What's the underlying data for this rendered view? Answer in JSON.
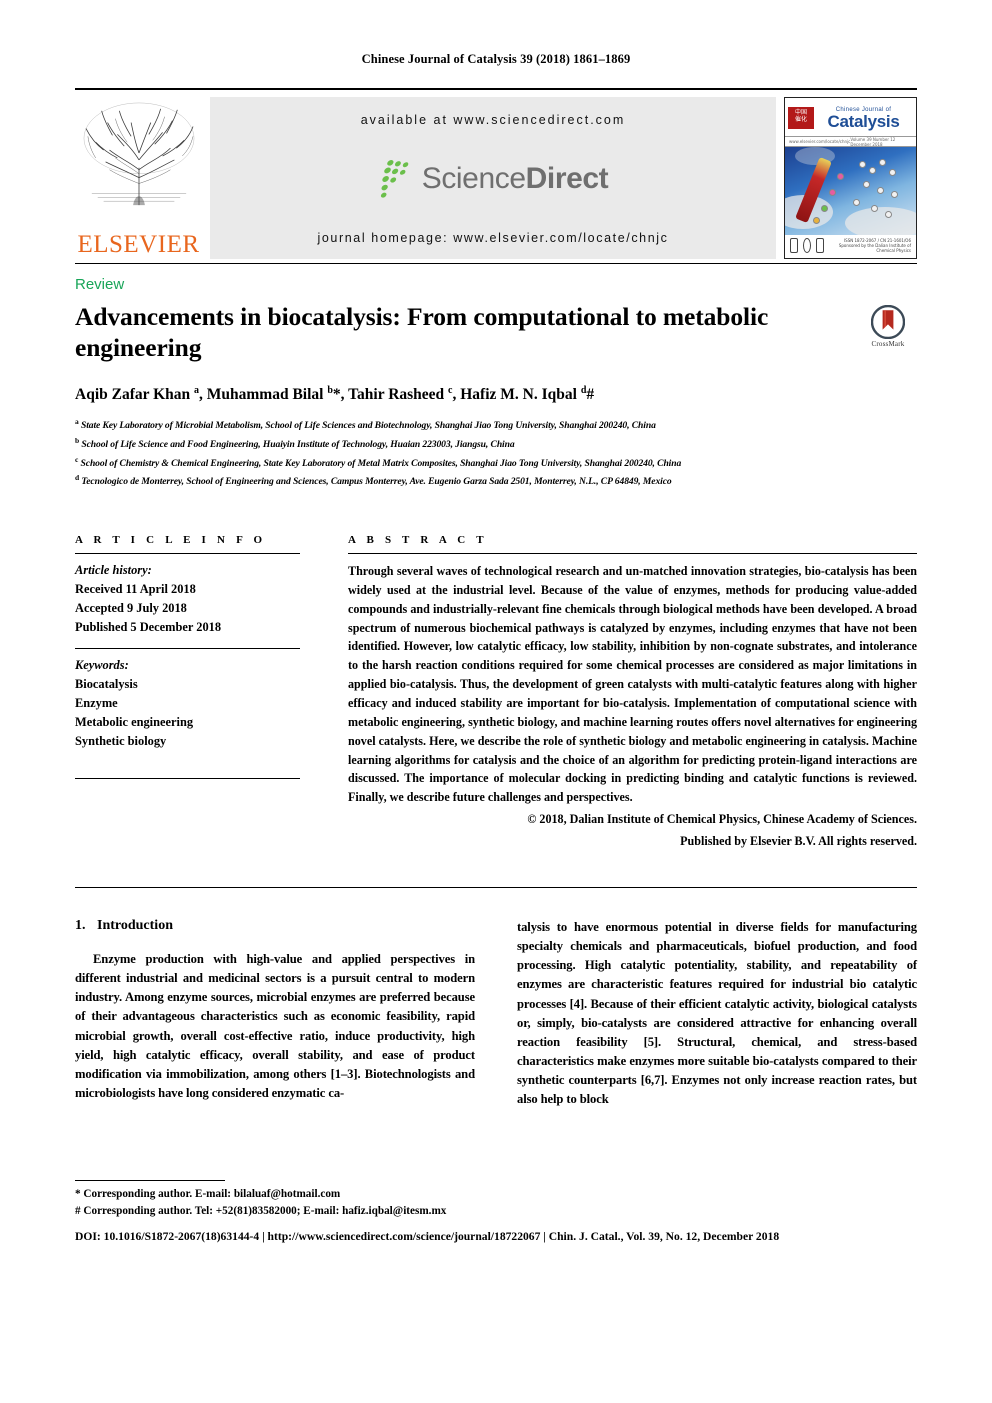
{
  "running_head": "Chinese Journal of Catalysis 39 (2018) 1861–1869",
  "masthead": {
    "publisher_name": "ELSEVIER",
    "available_at": "available at www.sciencedirect.com",
    "sciencedirect_wordmark_light": "Science",
    "sciencedirect_wordmark_bold": "Direct",
    "journal_homepage": "journal homepage: www.elsevier.com/locate/chnjc",
    "cover": {
      "title_small": "Chinese Journal of",
      "title_large": "Catalysis",
      "rule_left": "www.elsevier.com/locate/chnjc",
      "rule_right": "Volume 39   Number 12   December 2018",
      "footer_text": "ISSN 1872-2067 / CN 21-1601/O6  Sponsored by the Dalian Institute of Chemical Physics"
    }
  },
  "article": {
    "type_label": "Review",
    "title": "Advancements in biocatalysis: From computational to metabolic engineering",
    "crossmark_label": "CrossMark",
    "authors_html": "Aqib Zafar Khan <sup>a</sup>, Muhammad Bilal <sup>b</sup>*, Tahir Rasheed <sup>c</sup>, Hafiz M. N. Iqbal <sup>d</sup>#",
    "affiliations": [
      {
        "marker": "a",
        "text": "State Key Laboratory of Microbial Metabolism, School of Life Sciences and Biotechnology, Shanghai Jiao Tong University, Shanghai 200240, China"
      },
      {
        "marker": "b",
        "text": "School of Life Science and Food Engineering, Huaiyin Institute of Technology, Huaian 223003, Jiangsu, China"
      },
      {
        "marker": "c",
        "text": "School of Chemistry & Chemical Engineering, State Key Laboratory of Metal Matrix Composites, Shanghai Jiao Tong University, Shanghai 200240, China"
      },
      {
        "marker": "d",
        "text": "Tecnologico de Monterrey, School of Engineering and Sciences, Campus Monterrey, Ave. Eugenio Garza Sada 2501, Monterrey, N.L., CP 64849, Mexico"
      }
    ]
  },
  "article_info": {
    "heading": "A R T I C L E   I N F O",
    "history_label": "Article history:",
    "history": [
      "Received 11 April 2018",
      "Accepted 9 July 2018",
      "Published 5 December 2018"
    ],
    "keywords_label": "Keywords:",
    "keywords": [
      "Biocatalysis",
      "Enzyme",
      "Metabolic engineering",
      "Synthetic biology"
    ]
  },
  "abstract": {
    "heading": "A B S T R A C T",
    "text": "Through several waves of technological research and un-matched innovation strategies, bio-catalysis has been widely used at the industrial level. Because of the value of enzymes, methods for producing value-added compounds and industrially-relevant fine chemicals through biological methods have been developed. A broad spectrum of numerous biochemical pathways is catalyzed by enzymes, including enzymes that have not been identified. However, low catalytic efficacy, low stability, inhibition by non-cognate substrates, and intolerance to the harsh reaction conditions required for some chemical processes are considered as major limitations in applied bio-catalysis. Thus, the development of green catalysts with multi-catalytic features along with higher efficacy and induced stability are important for bio-catalysis. Implementation of computational science with metabolic engineering, synthetic biology, and machine learning routes offers novel alternatives for engineering novel catalysts. Here, we describe the role of synthetic biology and metabolic engineering in catalysis. Machine learning algorithms for catalysis and the choice of an algorithm for predicting protein-ligand interactions are discussed. The importance of molecular docking in predicting binding and catalytic functions is reviewed. Finally, we describe future challenges and perspectives.",
    "copyright_line1": "© 2018, Dalian Institute of Chemical Physics, Chinese Academy of Sciences.",
    "copyright_line2": "Published by Elsevier B.V. All rights reserved."
  },
  "body": {
    "section_number": "1.",
    "section_title": "Introduction",
    "left_paragraph": "Enzyme production with high-value and applied perspectives in different industrial and medicinal sectors is a pursuit central to modern industry. Among enzyme sources, microbial enzymes are preferred because of their advantageous characteristics such as economic feasibility, rapid microbial growth, overall cost-effective ratio, induce productivity, high yield, high catalytic efficacy, overall stability, and ease of product modification via immobilization, among others [1–3]. Biotechnologists and microbiologists have long considered enzymatic ca-",
    "right_paragraph": "talysis to have enormous potential in diverse fields for manufacturing specialty chemicals and pharmaceuticals, biofuel production, and food processing. High catalytic potentiality, stability, and repeatability of enzymes are characteristic features required for industrial bio catalytic processes [4]. Because of their efficient catalytic activity, biological catalysts or, simply, bio-catalysts are considered attractive for enhancing overall reaction feasibility [5]. Structural, chemical, and stress-based characteristics make enzymes more suitable bio-catalysts compared to their synthetic counterparts [6,7]. Enzymes not only increase reaction rates, but also help to block"
  },
  "footnotes": {
    "corresponding_1": "* Corresponding author. E-mail: bilaluaf@hotmail.com",
    "corresponding_2": "# Corresponding author. Tel: +52(81)83582000; E-mail: hafiz.iqbal@itesm.mx",
    "doi_line": "DOI: 10.1016/S1872-2067(18)63144-4 | http://www.sciencedirect.com/science/journal/18722067 | Chin. J. Catal., Vol. 39, No. 12, December 2018"
  },
  "colors": {
    "elsevier_orange": "#e8661e",
    "review_green": "#18a558",
    "sciencedirect_gray": "#6f6f6f",
    "banner_bg": "#eaeaea",
    "crossmark_red": "#b5291f",
    "cover_blue": "#1f4e96"
  }
}
